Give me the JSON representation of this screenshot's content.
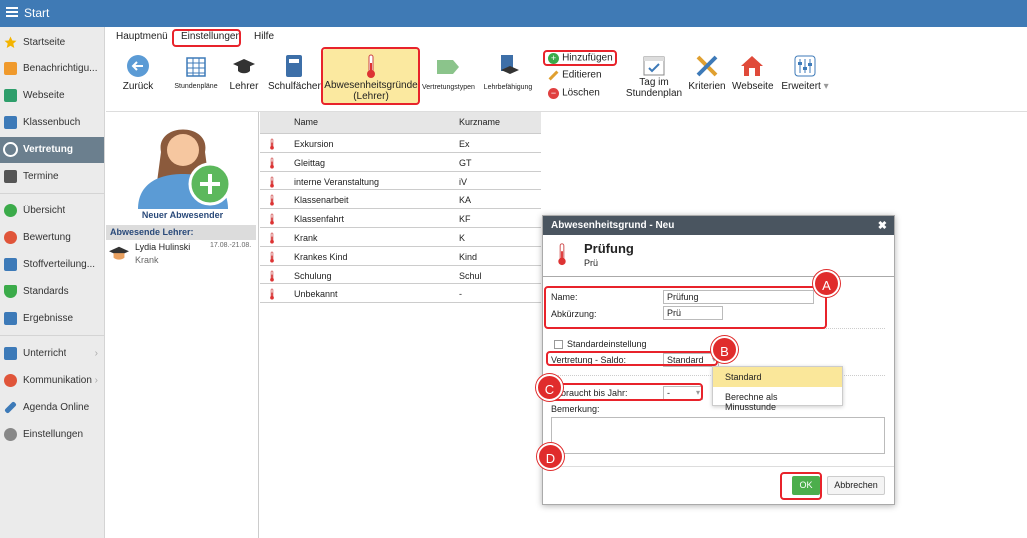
{
  "topbar": {
    "title": "Start"
  },
  "sidebar": {
    "items": [
      {
        "label": "Startseite",
        "icon": "star-icon",
        "color": "#f4b400"
      },
      {
        "label": "Benachrichtigu...",
        "icon": "mail-icon",
        "color": "#f09a2c"
      },
      {
        "label": "Webseite",
        "icon": "home-icon",
        "color": "#2e9e6b"
      },
      {
        "label": "Klassenbuch",
        "icon": "book-icon",
        "color": "#3d7ab8"
      },
      {
        "label": "Vertretung",
        "icon": "user-icon",
        "color": "#ffffff"
      },
      {
        "label": "Termine",
        "icon": "calendar-icon",
        "color": "#555555"
      },
      {
        "label": "Übersicht",
        "icon": "check-icon",
        "color": "#3bab4a"
      },
      {
        "label": "Bewertung",
        "icon": "rating-icon",
        "color": "#e0553a"
      },
      {
        "label": "Stoffverteilung...",
        "icon": "briefcase-icon",
        "color": "#3d7ab8"
      },
      {
        "label": "Standards",
        "icon": "shield-icon",
        "color": "#3bab4a"
      },
      {
        "label": "Ergebnisse",
        "icon": "chart-icon",
        "color": "#3d7ab8"
      },
      {
        "label": "Unterricht",
        "icon": "monitor-icon",
        "color": "#3d7ab8"
      },
      {
        "label": "Kommunikation",
        "icon": "chat-icon",
        "color": "#e0553a"
      },
      {
        "label": "Agenda Online",
        "icon": "pen-icon",
        "color": "#3d7ab8"
      },
      {
        "label": "Einstellungen",
        "icon": "gear-icon",
        "color": "#888888"
      }
    ]
  },
  "menubar": {
    "items": [
      "Hauptmenü",
      "Einstellungen",
      "Hilfe"
    ]
  },
  "ribbon": {
    "back": "Zurück",
    "stundenplaene": "Stundenpläne",
    "lehrer": "Lehrer",
    "schulfaecher": "Schulfächer",
    "abwesenheitsgruende_1": "Abwesenheitsgründe",
    "abwesenheitsgruende_2": "(Lehrer)",
    "vertretungstypen": "Vertretungstypen",
    "lehrbefaehigung": "Lehrbefähigung",
    "add": "Hinzufügen",
    "edit": "Editieren",
    "delete": "Löschen",
    "tag_im_1": "Tag im",
    "tag_im_2": "Stundenplan",
    "kriterien": "Kriterien",
    "webseite": "Webseite",
    "erweitert": "Erweitert"
  },
  "leftpanel": {
    "new_absent": "Neuer Abwesender",
    "absent_header": "Abwesende Lehrer:",
    "absent_name": "Lydia Hulinski",
    "absent_dates": "17.08.-21.08.",
    "absent_reason": "Krank"
  },
  "grid": {
    "headers": [
      "Name",
      "Kurzname"
    ],
    "rows": [
      {
        "name": "Exkursion",
        "short": "Ex"
      },
      {
        "name": "Gleittag",
        "short": "GT"
      },
      {
        "name": "interne Veranstaltung",
        "short": "iV"
      },
      {
        "name": "Klassenarbeit",
        "short": "KA"
      },
      {
        "name": "Klassenfahrt",
        "short": "KF"
      },
      {
        "name": "Krank",
        "short": "K"
      },
      {
        "name": "Krankes Kind",
        "short": "Kind"
      },
      {
        "name": "Schulung",
        "short": "Schul"
      },
      {
        "name": "Unbekannt",
        "short": "-"
      }
    ]
  },
  "dialog": {
    "title": "Abwesenheitsgrund - Neu",
    "heading": "Prüfung",
    "subheading": "Prü",
    "name_label": "Name:",
    "name_value": "Prüfung",
    "abk_label": "Abkürzung:",
    "abk_value": "Prü",
    "standard_label": "Standardeinstellung",
    "saldo_label": "Vertretung - Saldo:",
    "saldo_value": "Standard",
    "jahr_label": "gebraucht bis Jahr:",
    "jahr_value": "-",
    "bemerkung_label": "Bemerkung:",
    "ok": "OK",
    "cancel": "Abbrechen"
  },
  "dropdown": {
    "options": [
      "Standard",
      "Berechne als Minusstunde"
    ]
  },
  "badges": [
    "A",
    "B",
    "C",
    "D"
  ]
}
